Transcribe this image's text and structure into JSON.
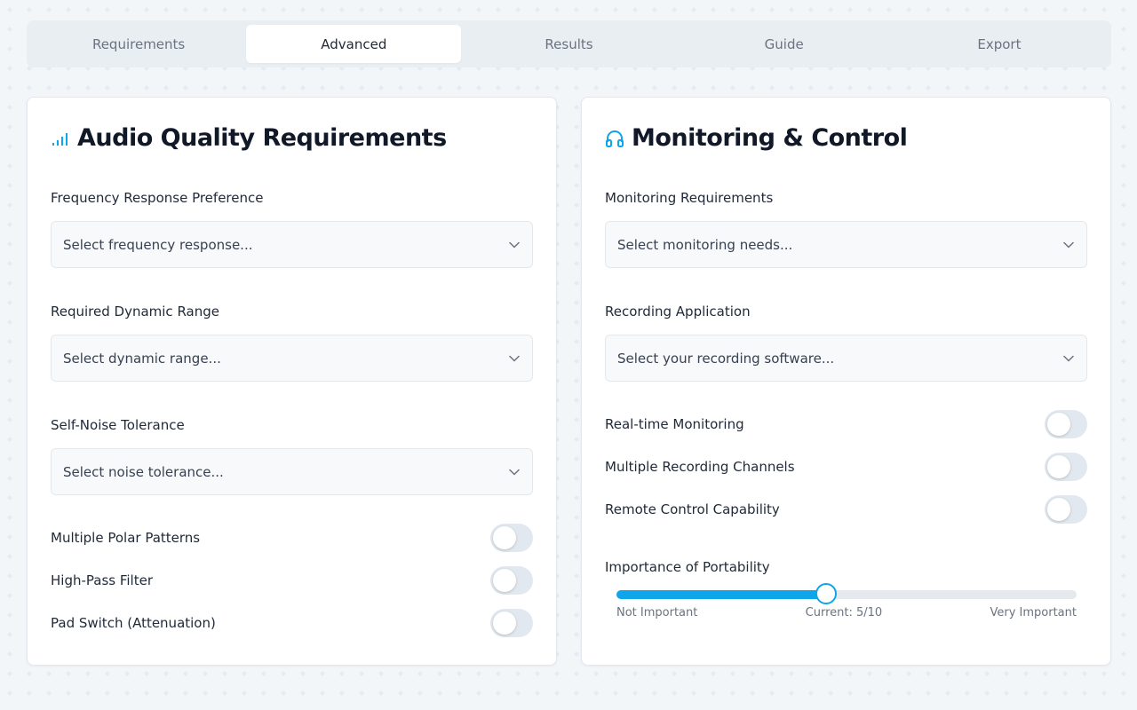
{
  "tabs": [
    {
      "label": "Requirements"
    },
    {
      "label": "Advanced"
    },
    {
      "label": "Results"
    },
    {
      "label": "Guide"
    },
    {
      "label": "Export"
    }
  ],
  "active_tab": "Advanced",
  "accent_color": "#0ea5e9",
  "audio_quality": {
    "title": "Audio Quality Requirements",
    "icon": "signal-bars-icon",
    "fields": [
      {
        "label": "Frequency Response Preference",
        "placeholder": "Select frequency response..."
      },
      {
        "label": "Required Dynamic Range",
        "placeholder": "Select dynamic range..."
      },
      {
        "label": "Self-Noise Tolerance",
        "placeholder": "Select noise tolerance..."
      }
    ],
    "toggles": [
      {
        "label": "Multiple Polar Patterns",
        "on": false
      },
      {
        "label": "High-Pass Filter",
        "on": false
      },
      {
        "label": "Pad Switch (Attenuation)",
        "on": false
      }
    ]
  },
  "monitoring": {
    "title": "Monitoring & Control",
    "icon": "headphones-icon",
    "fields": [
      {
        "label": "Monitoring Requirements",
        "placeholder": "Select monitoring needs..."
      },
      {
        "label": "Recording Application",
        "placeholder": "Select your recording software..."
      }
    ],
    "toggles": [
      {
        "label": "Real-time Monitoring",
        "on": false
      },
      {
        "label": "Multiple Recording Channels",
        "on": false
      },
      {
        "label": "Remote Control Capability",
        "on": false
      }
    ],
    "portability": {
      "label": "Importance of Portability",
      "value": 5,
      "max": 10,
      "min_label": "Not Important",
      "current_label": "Current: 5/10",
      "max_label": "Very Important"
    }
  }
}
